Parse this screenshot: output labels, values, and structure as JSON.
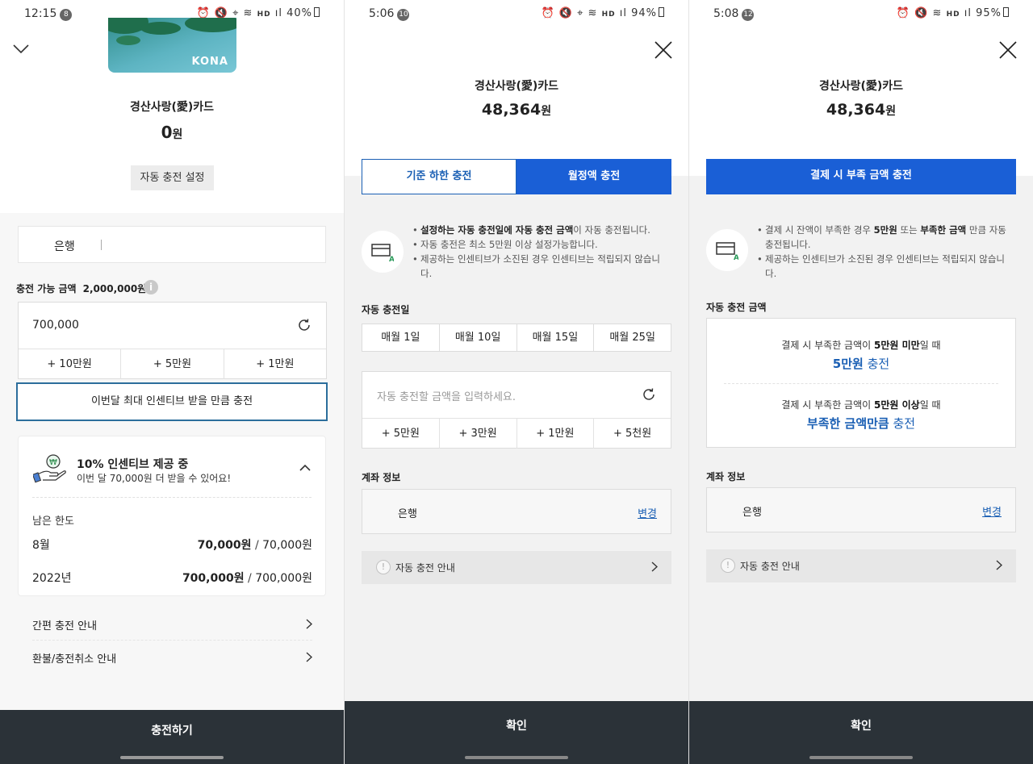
{
  "screen1": {
    "status": {
      "time": "12:15",
      "badge": "8",
      "battery": "40%"
    },
    "card_brand": "KONA",
    "card_name": "경산사랑(愛)카드",
    "balance": "0",
    "balance_unit": "원",
    "auto_charge_button": "자동 충전 설정",
    "bank_label": "은행",
    "available_label": "충전 가능 금액",
    "available_value": "2,000,000원",
    "amount_value": "700,000",
    "quick_add": [
      "+ 10만원",
      "+ 5만원",
      "+ 1만원"
    ],
    "incentive_button": "이번달 최대 인센티브 받을 만큼 충전",
    "incentive": {
      "title": "10% 인센티브 제공 중",
      "subtitle": "이번 달 70,000원 더 받을 수 있어요!",
      "remaining_label": "남은 한도",
      "rows": [
        {
          "label": "8월",
          "remaining": "70,000원",
          "total": "70,000원"
        },
        {
          "label": "2022년",
          "remaining": "700,000원",
          "total": "700,000원"
        }
      ]
    },
    "links": [
      "간편 충전 안내",
      "환불/충전취소 안내"
    ],
    "submit": "충전하기"
  },
  "screen2": {
    "status": {
      "time": "5:06",
      "badge": "10",
      "battery": "94%"
    },
    "card_name": "경산사랑(愛)카드",
    "balance": "48,364",
    "balance_unit": "원",
    "tabs": [
      "기준 하한 충전",
      "월정액 충전"
    ],
    "guide": {
      "line1_a": "설정하는 자동 충전일에 자동 충전 금액",
      "line1_b": "이 자동 충전됩니다.",
      "line2": "자동 충전은 최소 5만원 이상 설정가능합니다.",
      "line3": "제공하는 인센티브가 소진된 경우 인센티브는 적립되지 않습니다."
    },
    "day_label": "자동 충전일",
    "days": [
      "매월 1일",
      "매월 10일",
      "매월 15일",
      "매월 25일"
    ],
    "amount_placeholder": "자동 충전할 금액을 입력하세요.",
    "quick_add": [
      "+ 5만원",
      "+ 3만원",
      "+ 1만원",
      "+ 5천원"
    ],
    "account_label": "계좌 정보",
    "bank_label": "은행",
    "change_link": "변경",
    "notice": "자동 충전 안내",
    "confirm": "확인"
  },
  "screen3": {
    "status": {
      "time": "5:08",
      "badge": "12",
      "battery": "95%"
    },
    "card_name": "경산사랑(愛)카드",
    "balance": "48,364",
    "balance_unit": "원",
    "tab": "결제 시 부족 금액 충전",
    "guide": {
      "line1_pre": "결제 시 잔액이 부족한 경우 ",
      "line1_b1": "5만원",
      "line1_mid": " 또는 ",
      "line1_b2": "부족한 금액",
      "line1_post": " 만큼 자동 충전됩니다.",
      "line2": "제공하는 인센티브가 소진된 경우 인센티브는 적립되지 않습니다."
    },
    "amount_label": "자동 충전 금액",
    "cond1_pre": "결제 시 부족한 금액이 ",
    "cond1_b": "5만원 미만",
    "cond1_post": "일 때",
    "cond1_strong": "5만원",
    "cond1_strong_post": " 충전",
    "cond2_pre": "결제 시 부족한 금액이 ",
    "cond2_b": "5만원 이상",
    "cond2_post": "일 때",
    "cond2_strong": "부족한 금액만큼",
    "cond2_strong_post": " 충전",
    "account_label": "계좌 정보",
    "bank_label": "은행",
    "change_link": "변경",
    "notice": "자동 충전 안내",
    "confirm": "확인"
  },
  "colors": {
    "accent": "#1a5fd6",
    "link": "#1a5fb4",
    "bottom_bar": "#2b3238",
    "highlight_border": "#2c6e9c"
  }
}
